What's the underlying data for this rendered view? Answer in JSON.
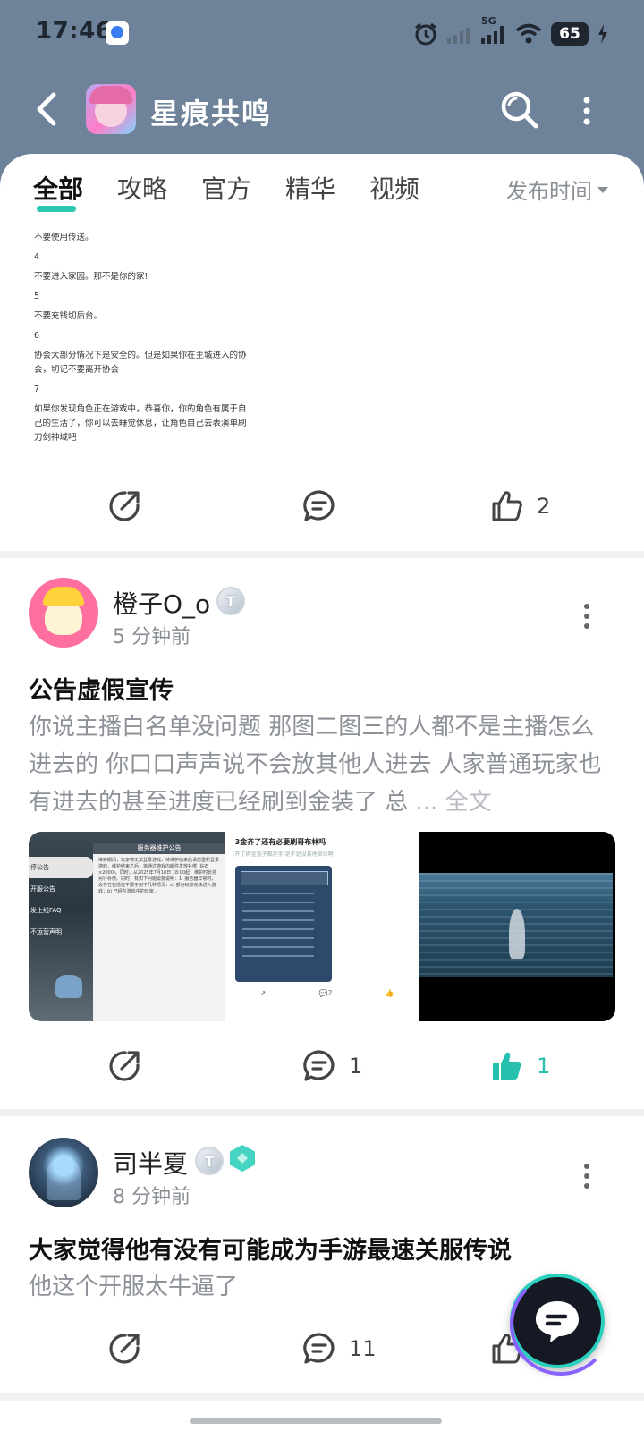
{
  "status_bar": {
    "time": "17:46",
    "network": "5G",
    "battery": "65"
  },
  "header": {
    "title": "星痕共鸣"
  },
  "tabs": [
    {
      "label": "全部",
      "active": true
    },
    {
      "label": "攻略",
      "active": false
    },
    {
      "label": "官方",
      "active": false
    },
    {
      "label": "精华",
      "active": false
    },
    {
      "label": "视频",
      "active": false
    }
  ],
  "sort": {
    "label": "发布时间"
  },
  "post1": {
    "lines": [
      "不要使用传送。",
      "4",
      "不要进入家园。那不是你的家!",
      "5",
      "不要充钱切后台。",
      "6",
      "协会大部分情况下是安全的。但是如果你在主城进入的协会，切记不要离开协会",
      "7",
      "如果你发现角色正在游戏中，恭喜你，你的角色有属于自己的生活了，你可以去睡觉休息，让角色自己去表演单刷刀剑神域吧"
    ],
    "likes": "2"
  },
  "post2": {
    "username": "橙子O_o",
    "level": "T",
    "time": "5 分钟前",
    "title": "公告虚假宣传",
    "body": "你说主播白名单没问题 那图二图三的人都不是主播怎么进去的 你口口声声说不会放其他人进去 人家普通玩家也有进去的甚至进度已经刷到金装了 总",
    "ellipsis": "...",
    "fulltext_label": "全文",
    "comments": "1",
    "likes": "1",
    "images": {
      "img1": {
        "header": "服务器维护公告",
        "menu": [
          "停公告",
          "开服公告",
          "发上线FAQ",
          "不运营声明"
        ],
        "body": "维护期间，玩家将无法登录游戏，待维护结束后请您重新登录游戏。维护结束之后，将通过游戏内邮件发放补偿 (钻石×2000)。同时，从2025年7月18日 18:00起，维护时长将另行补偿。同时，有如下问题需要说明：1. 服务器异常时，会存在包括但不限于如下几种情况：a) 部分玩家无法进入游戏；b) 已经在游戏中的玩家..."
      },
      "img2": {
        "title": "3金齐了还有必要刷哥布林吗",
        "subtitle": "开了俩金直子都是手 是不是没其他部位啊",
        "comments": "2"
      }
    }
  },
  "post3": {
    "username": "司半夏",
    "level": "T",
    "time": "8 分钟前",
    "title": "大家觉得他有没有可能成为手游最速关服传说",
    "body": "他这个开服太牛逼了",
    "comments": "11"
  },
  "colors": {
    "header_bg": "#6e8299",
    "accent": "#2ec7b4",
    "like_active": "#27c0ae"
  }
}
